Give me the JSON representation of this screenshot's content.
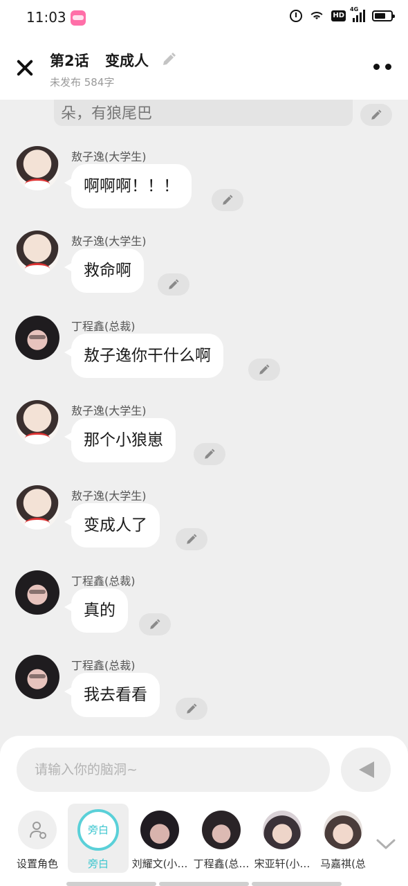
{
  "status_bar": {
    "time": "11:03"
  },
  "header": {
    "episode_number": "第2话",
    "episode_title": "变成人",
    "subtitle": "未发布 584字"
  },
  "previous_message": {
    "text": "朵，有狼尾巴"
  },
  "messages": [
    {
      "speaker": "敖子逸(大学生)",
      "text": "啊啊啊！！！",
      "avatar": "light"
    },
    {
      "speaker": "敖子逸(大学生)",
      "text": "救命啊",
      "avatar": "light"
    },
    {
      "speaker": "丁程鑫(总裁)",
      "text": "敖子逸你干什么啊",
      "avatar": "dark"
    },
    {
      "speaker": "敖子逸(大学生)",
      "text": "那个小狼崽",
      "avatar": "light"
    },
    {
      "speaker": "敖子逸(大学生)",
      "text": "变成人了",
      "avatar": "light"
    },
    {
      "speaker": "丁程鑫(总裁)",
      "text": "真的",
      "avatar": "dark"
    },
    {
      "speaker": "丁程鑫(总裁)",
      "text": "我去看看",
      "avatar": "dark"
    }
  ],
  "input": {
    "placeholder": "请输入你的脑洞~",
    "value": ""
  },
  "characters": [
    {
      "label": "设置角色",
      "type": "settings"
    },
    {
      "label": "旁白",
      "type": "narrator",
      "selected": true,
      "circle_text": "旁白"
    },
    {
      "label": "刘耀文(小…",
      "type": "avatar"
    },
    {
      "label": "丁程鑫(总…",
      "type": "avatar"
    },
    {
      "label": "宋亚轩(小…",
      "type": "avatar"
    },
    {
      "label": "马嘉祺(总",
      "type": "avatar"
    }
  ],
  "colors": {
    "accent": "#3bc6cf",
    "background": "#efefef",
    "bubble": "#ffffff"
  },
  "icons": [
    "close-icon",
    "pencil-icon",
    "more-icon",
    "send-icon",
    "person-settings-icon",
    "chevron-down-icon",
    "alarm-icon",
    "wifi-icon",
    "signal-icon",
    "battery-icon"
  ]
}
